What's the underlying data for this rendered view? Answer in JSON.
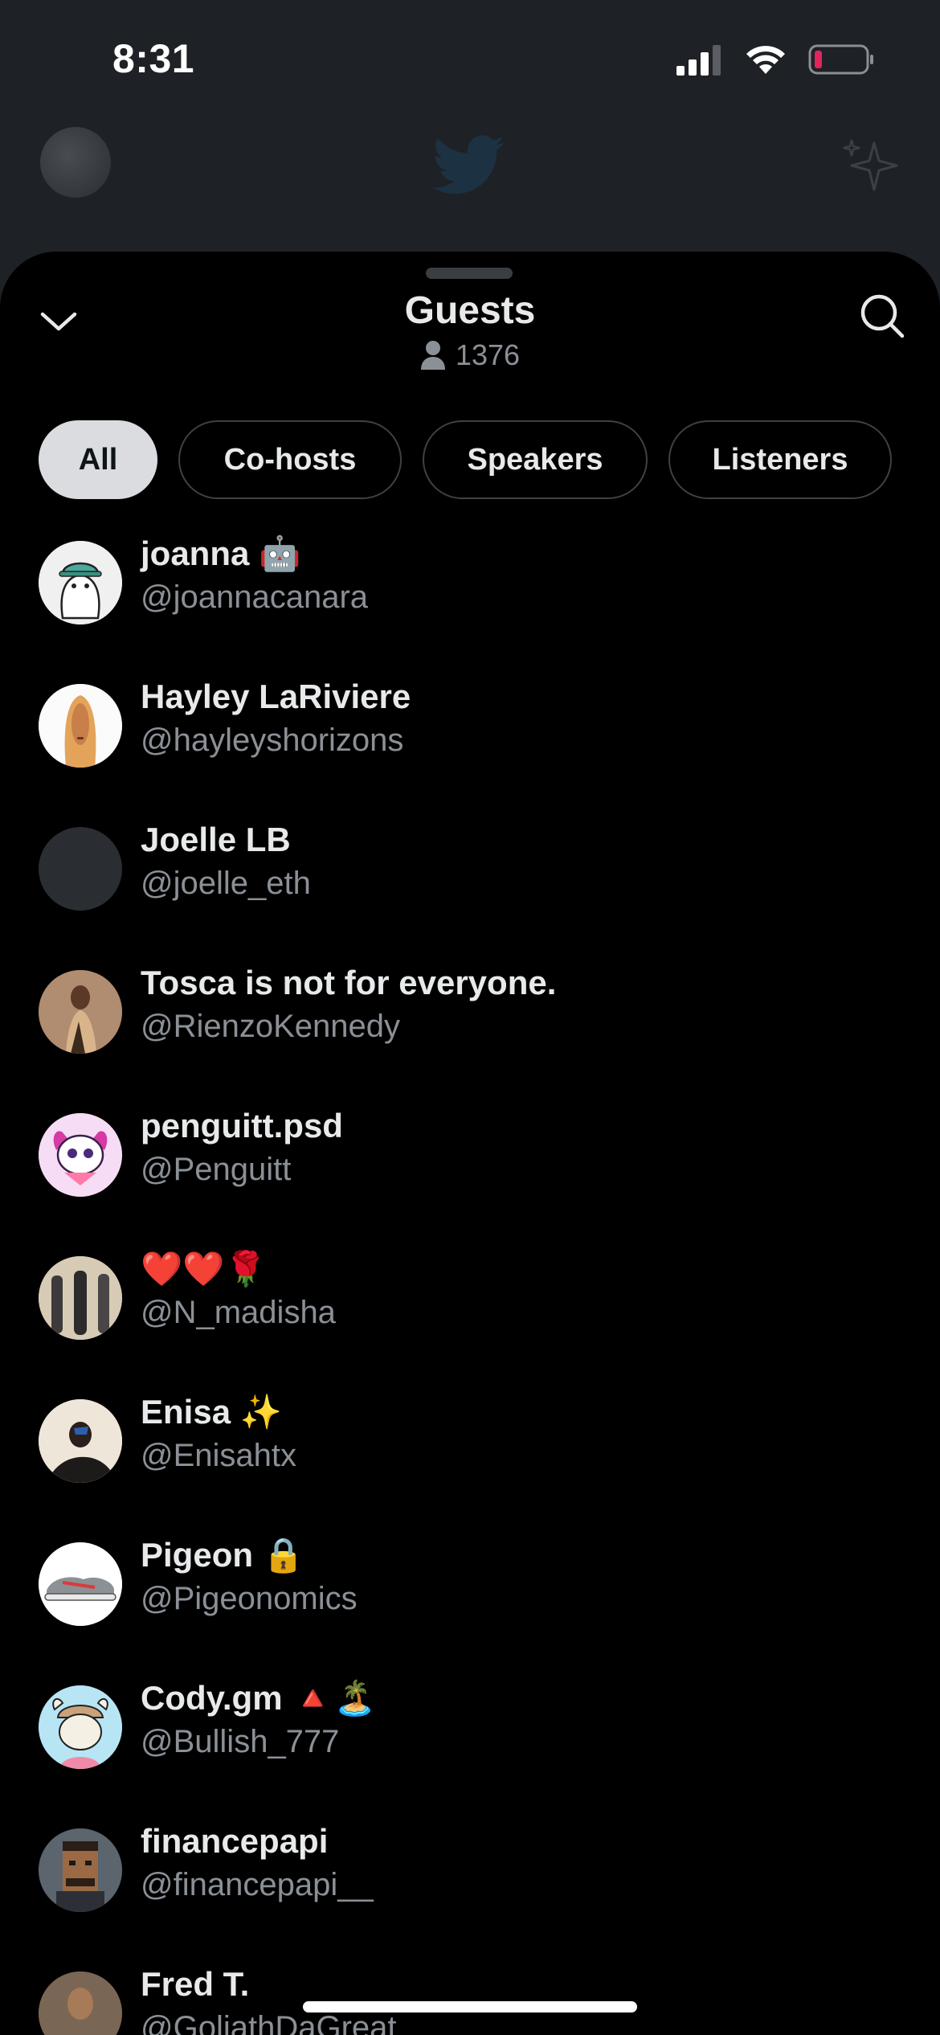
{
  "status_bar": {
    "time": "8:31"
  },
  "sheet": {
    "title": "Guests",
    "count": "1376"
  },
  "tabs": [
    {
      "label": "All",
      "active": true
    },
    {
      "label": "Co-hosts",
      "active": false
    },
    {
      "label": "Speakers",
      "active": false
    },
    {
      "label": "Listeners",
      "active": false
    }
  ],
  "guests": [
    {
      "name": "joanna 🤖",
      "handle": "@joannacanara"
    },
    {
      "name": "Hayley LaRiviere",
      "handle": "@hayleyshorizons"
    },
    {
      "name": "Joelle LB",
      "handle": "@joelle_eth"
    },
    {
      "name": "Tosca is not for everyone.",
      "handle": "@RienzoKennedy"
    },
    {
      "name": "penguitt.psd",
      "handle": "@Penguitt"
    },
    {
      "name": "❤️❤️🌹",
      "handle": "@N_madisha"
    },
    {
      "name": "Enisa ✨",
      "handle": "@Enisahtx"
    },
    {
      "name": "Pigeon 🔒",
      "handle": "@Pigeonomics"
    },
    {
      "name": "Cody.gm 🔺🏝️",
      "handle": "@Bullish_777"
    },
    {
      "name": "financepapi",
      "handle": "@financepapi__"
    },
    {
      "name": "Fred T.",
      "handle": "@GoliathDaGreat"
    }
  ],
  "colors": {
    "background": "#000000",
    "muted_text": "#8b9096",
    "battery_low": "#e0245e"
  }
}
